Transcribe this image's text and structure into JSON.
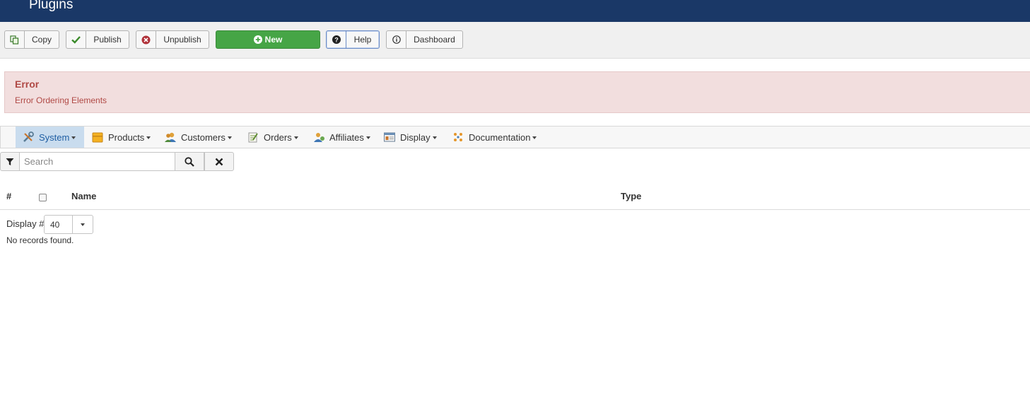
{
  "header": {
    "title": "Plugins"
  },
  "toolbar": {
    "copy_label": "Copy",
    "publish_label": "Publish",
    "unpublish_label": "Unpublish",
    "new_label": "New",
    "help_label": "Help",
    "dashboard_label": "Dashboard"
  },
  "alert": {
    "heading": "Error",
    "message": "Error Ordering Elements"
  },
  "menu": {
    "items": [
      {
        "label": "System",
        "icon": "tools-icon",
        "active": true
      },
      {
        "label": "Products",
        "icon": "products-box-icon"
      },
      {
        "label": "Customers",
        "icon": "customers-icon"
      },
      {
        "label": "Orders",
        "icon": "orders-icon"
      },
      {
        "label": "Affiliates",
        "icon": "affiliates-icon"
      },
      {
        "label": "Display",
        "icon": "display-window-icon"
      },
      {
        "label": "Documentation",
        "icon": "documentation-icon"
      }
    ]
  },
  "search": {
    "placeholder": "Search"
  },
  "table": {
    "columns": {
      "number": "#",
      "name": "Name",
      "type": "Type"
    },
    "display_label": "Display #",
    "display_value": "40",
    "empty_message": "No records found."
  },
  "colors": {
    "header_bg": "#1a3867",
    "new_button": "#46a546",
    "alert_bg": "#f2dede",
    "alert_text": "#b04945",
    "menu_active_bg": "#c9dcee"
  }
}
